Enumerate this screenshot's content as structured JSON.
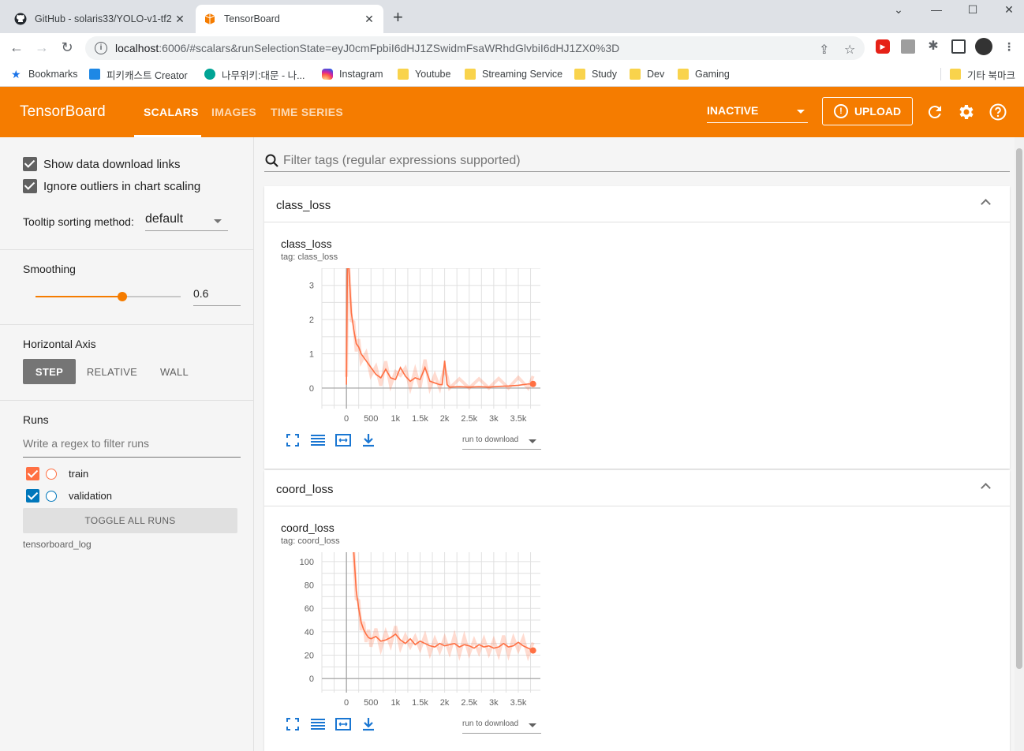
{
  "browser": {
    "tabs": [
      {
        "title": "GitHub - solaris33/YOLO-v1-tf2",
        "active": false
      },
      {
        "title": "TensorBoard",
        "active": true
      }
    ],
    "url_host": "localhost",
    "url_path": ":6006/#scalars&runSelectionState=eyJ0cmFpbiI6dHJ1ZSwidmFsaWRhdGlvbiI6dHJ1ZX0%3D",
    "bookmarks": [
      {
        "label": "Bookmarks",
        "icon": "star-icon"
      },
      {
        "label": "피키캐스트 Creator",
        "icon": "pikicast-icon"
      },
      {
        "label": "나무위키:대문 - 나...",
        "icon": "namuwiki-icon"
      },
      {
        "label": "Instagram",
        "icon": "instagram-icon"
      },
      {
        "label": "Youtube",
        "icon": "folder-icon"
      },
      {
        "label": "Streaming Service",
        "icon": "folder-icon"
      },
      {
        "label": "Study",
        "icon": "folder-icon"
      },
      {
        "label": "Dev",
        "icon": "folder-icon"
      },
      {
        "label": "Gaming",
        "icon": "folder-icon"
      }
    ],
    "other_bookmarks": "기타 북마크"
  },
  "header": {
    "logo": "TensorBoard",
    "tabs": [
      "SCALARS",
      "IMAGES",
      "TIME SERIES"
    ],
    "selected_tab": "SCALARS",
    "status": "INACTIVE",
    "upload_label": "UPLOAD",
    "accent_color": "#f57c00"
  },
  "sidebar": {
    "show_download_links": "Show data download links",
    "ignore_outliers": "Ignore outliers in chart scaling",
    "tooltip_label": "Tooltip sorting method:",
    "tooltip_value": "default",
    "smoothing_label": "Smoothing",
    "smoothing_value": "0.6",
    "smoothing_fraction": 0.6,
    "horizontal_axis_label": "Horizontal Axis",
    "axis_options": [
      "STEP",
      "RELATIVE",
      "WALL"
    ],
    "runs_label": "Runs",
    "regex_placeholder": "Write a regex to filter runs",
    "runs": [
      {
        "name": "train",
        "color": "#ff7043",
        "checked": true
      },
      {
        "name": "validation",
        "color": "#0077bb",
        "checked": true
      }
    ],
    "toggle_all": "TOGGLE ALL RUNS",
    "logdir": "tensorboard_log"
  },
  "main": {
    "filter_placeholder": "Filter tags (regular expressions supported)",
    "cards": [
      {
        "header": "class_loss",
        "title": "class_loss",
        "tag": "tag: class_loss",
        "run_to_download": "run to download"
      },
      {
        "header": "coord_loss",
        "title": "coord_loss",
        "tag": "tag: coord_loss",
        "run_to_download": "run to download"
      }
    ]
  },
  "chart_data": [
    {
      "type": "line",
      "title": "class_loss",
      "x_ticks": [
        "0",
        "500",
        "1k",
        "1.5k",
        "2k",
        "2.5k",
        "3k",
        "3.5k"
      ],
      "y_ticks": [
        "0",
        "1",
        "2",
        "3"
      ],
      "xlim": [
        -500,
        3950
      ],
      "ylim": [
        -0.6,
        3.5
      ],
      "series": [
        {
          "name": "train",
          "color": "#ff7043",
          "x": [
            0,
            20,
            50,
            100,
            150,
            200,
            250,
            300,
            400,
            500,
            600,
            700,
            800,
            900,
            1000,
            1100,
            1200,
            1300,
            1400,
            1500,
            1600,
            1700,
            1800,
            1900,
            1950,
            2000,
            2050,
            2100,
            2300,
            2500,
            2700,
            2900,
            3100,
            3300,
            3500,
            3700,
            3800
          ],
          "y": [
            0.1,
            3.5,
            3.5,
            2.2,
            1.7,
            1.3,
            1.2,
            1.0,
            0.8,
            0.6,
            0.4,
            0.3,
            0.55,
            0.3,
            0.25,
            0.6,
            0.35,
            0.2,
            0.3,
            0.25,
            0.6,
            0.2,
            0.15,
            0.1,
            0.1,
            0.8,
            0.1,
            0.03,
            0.04,
            0.03,
            0.04,
            0.03,
            0.05,
            0.06,
            0.08,
            0.12,
            0.12
          ]
        }
      ]
    },
    {
      "type": "line",
      "title": "coord_loss",
      "x_ticks": [
        "0",
        "500",
        "1k",
        "1.5k",
        "2k",
        "2.5k",
        "3k",
        "3.5k"
      ],
      "y_ticks": [
        "0",
        "20",
        "40",
        "60",
        "80",
        "100"
      ],
      "xlim": [
        -500,
        3950
      ],
      "ylim": [
        -12,
        108
      ],
      "series": [
        {
          "name": "train",
          "color": "#ff7043",
          "x": [
            150,
            200,
            250,
            300,
            350,
            400,
            450,
            500,
            600,
            700,
            800,
            900,
            1000,
            1100,
            1200,
            1300,
            1400,
            1500,
            1600,
            1700,
            1800,
            1900,
            2000,
            2100,
            2200,
            2300,
            2400,
            2500,
            2600,
            2700,
            2800,
            2900,
            3000,
            3100,
            3200,
            3300,
            3400,
            3500,
            3600,
            3700,
            3800
          ],
          "y": [
            108,
            75,
            60,
            48,
            42,
            38,
            35,
            34,
            36,
            32,
            33,
            35,
            38,
            33,
            30,
            34,
            29,
            32,
            30,
            28,
            27,
            30,
            28,
            29,
            30,
            27,
            29,
            28,
            26,
            29,
            27,
            28,
            26,
            27,
            30,
            27,
            28,
            31,
            28,
            26,
            24
          ]
        }
      ]
    }
  ]
}
